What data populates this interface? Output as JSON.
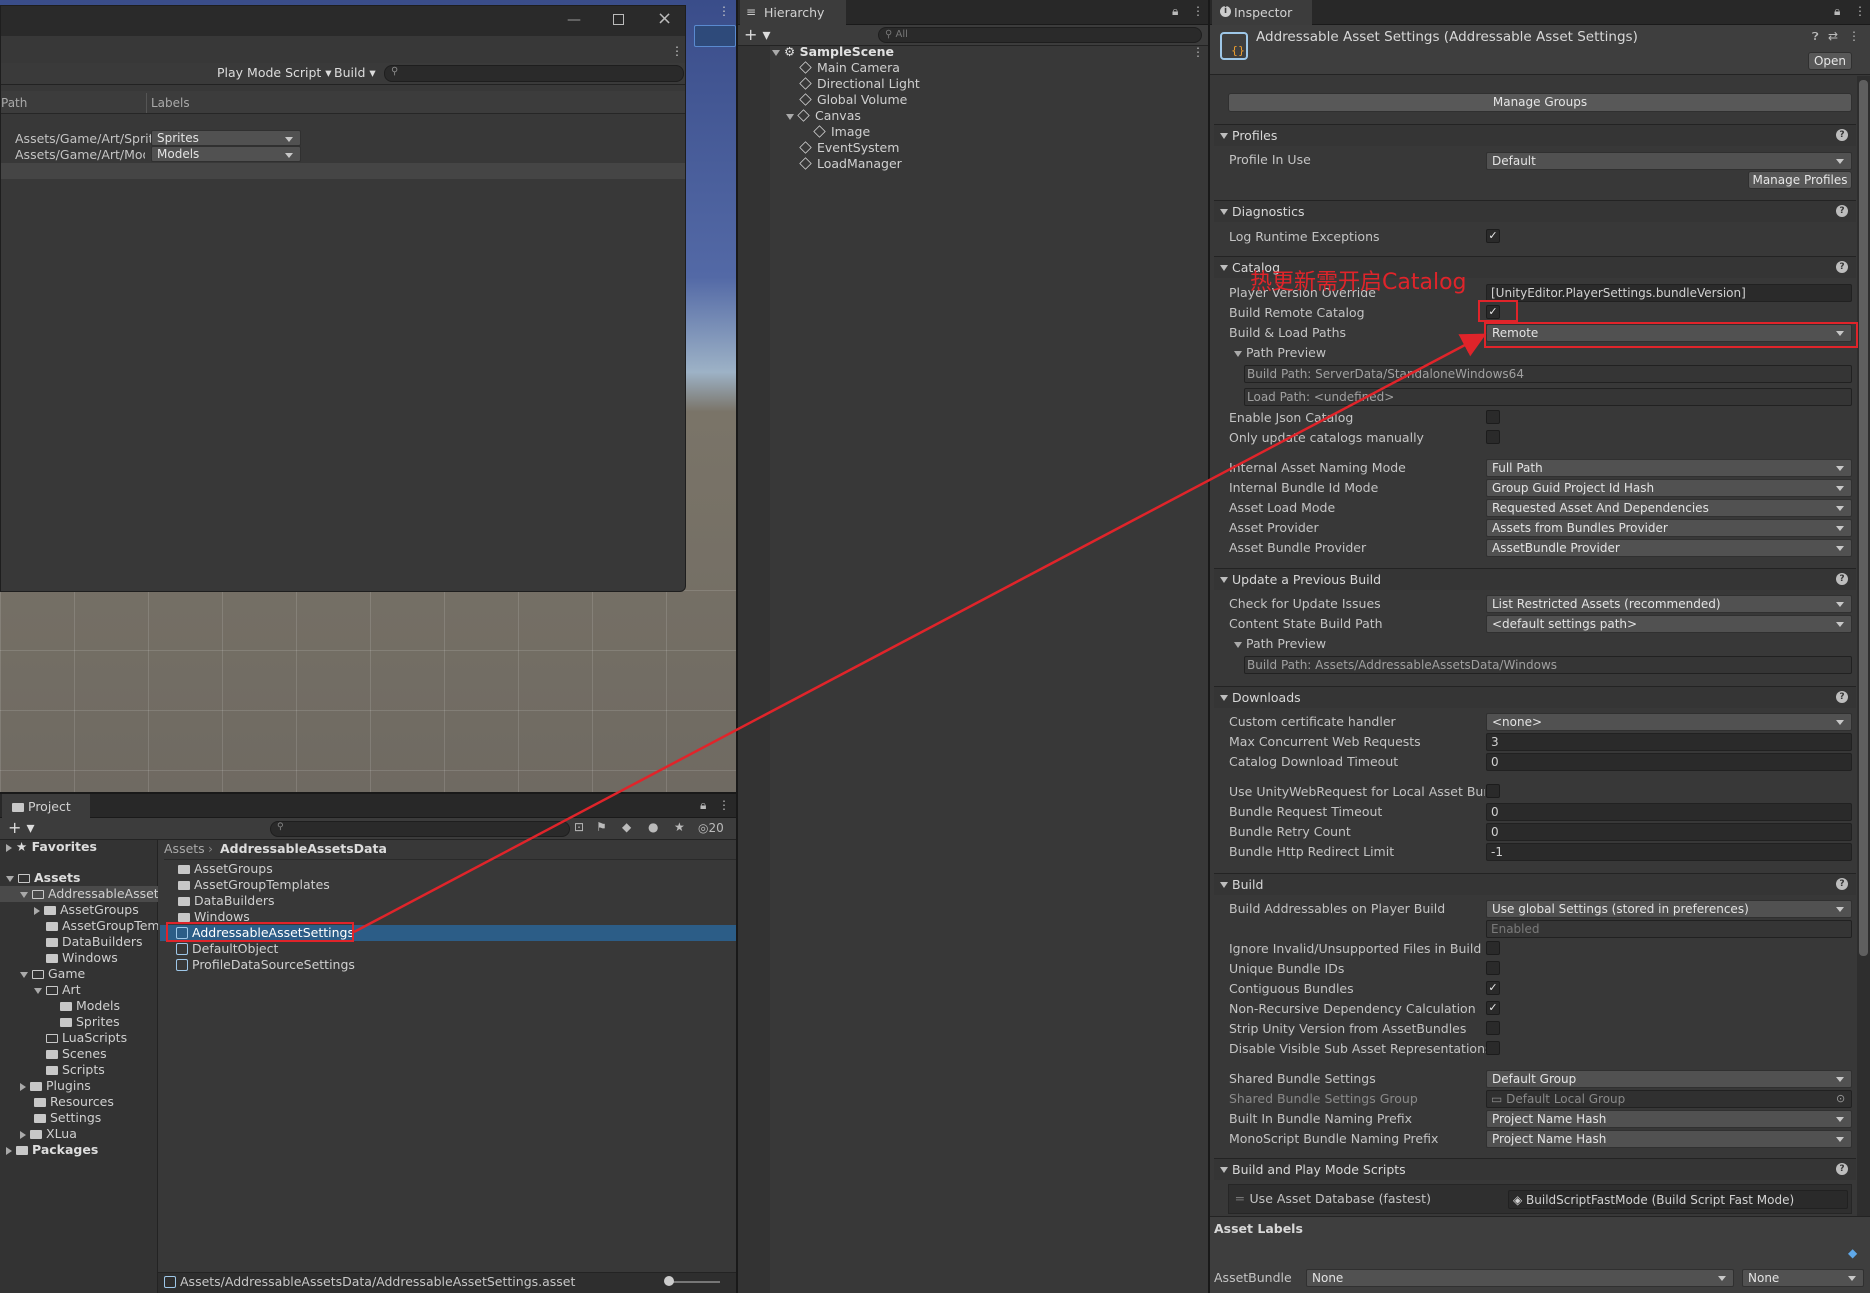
{
  "groups_window": {
    "toolbar": {
      "play_mode_script": "Play Mode Script",
      "build": "Build"
    },
    "columns": {
      "path": "Path",
      "labels": "Labels"
    },
    "rows": [
      {
        "path": "Assets/Game/Art/Sprit",
        "label": "Sprites"
      },
      {
        "path": "Assets/Game/Art/Mod",
        "label": "Models"
      }
    ]
  },
  "hierarchy": {
    "tab": "Hierarchy",
    "search_placeholder": "All",
    "scene": "SampleScene",
    "items": [
      "Main Camera",
      "Directional Light",
      "Global Volume",
      "Canvas",
      "Image",
      "EventSystem",
      "LoadManager"
    ]
  },
  "project": {
    "tab": "Project",
    "count": "20",
    "favorites": "Favorites",
    "assets": "Assets",
    "tree": [
      "AddressableAssets",
      "AssetGroups",
      "AssetGroupTemp",
      "DataBuilders",
      "Windows",
      "Game",
      "Art",
      "Models",
      "Sprites",
      "LuaScripts",
      "Scenes",
      "Scripts",
      "Plugins",
      "Resources",
      "Settings",
      "XLua",
      "Packages"
    ],
    "breadcrumb": {
      "root": "Assets",
      "current": "AddressableAssetsData"
    },
    "files": [
      "AssetGroups",
      "AssetGroupTemplates",
      "DataBuilders",
      "Windows",
      "AddressableAssetSettings",
      "DefaultObject",
      "ProfileDataSourceSettings"
    ],
    "status_path": "Assets/AddressableAssetsData/AddressableAssetSettings.asset"
  },
  "inspector": {
    "tab": "Inspector",
    "title": "Addressable Asset Settings (Addressable Asset Settings)",
    "open_button": "Open",
    "manage_groups": "Manage Groups",
    "profiles": {
      "header": "Profiles",
      "profile_in_use_label": "Profile In Use",
      "profile_in_use": "Default",
      "manage_profiles": "Manage Profiles"
    },
    "diagnostics": {
      "header": "Diagnostics",
      "log_runtime_exceptions": "Log Runtime Exceptions"
    },
    "catalog": {
      "header": "Catalog",
      "player_version_override_label": "Player Version Override",
      "player_version_override": "[UnityEditor.PlayerSettings.bundleVersion]",
      "build_remote_catalog": "Build Remote Catalog",
      "build_load_paths_label": "Build & Load Paths",
      "build_load_paths": "Remote",
      "path_preview": "Path Preview",
      "build_path": "Build Path: ServerData/StandaloneWindows64",
      "load_path": "Load Path: <undefined>",
      "enable_json_catalog": "Enable Json Catalog",
      "only_update_manually": "Only update catalogs manually",
      "internal_asset_naming_mode_label": "Internal Asset Naming Mode",
      "internal_asset_naming_mode": "Full Path",
      "internal_bundle_id_mode_label": "Internal Bundle Id Mode",
      "internal_bundle_id_mode": "Group Guid Project Id Hash",
      "asset_load_mode_label": "Asset Load Mode",
      "asset_load_mode": "Requested Asset And Dependencies",
      "asset_provider_label": "Asset Provider",
      "asset_provider": "Assets from Bundles Provider",
      "asset_bundle_provider_label": "Asset Bundle Provider",
      "asset_bundle_provider": "AssetBundle Provider"
    },
    "update_previous": {
      "header": "Update a Previous Build",
      "check_label": "Check for Update Issues",
      "check": "List Restricted Assets (recommended)",
      "content_state_label": "Content State Build Path",
      "content_state": "<default settings path>",
      "path_preview": "Path Preview",
      "build_path": "Build Path: Assets/AddressableAssetsData/Windows"
    },
    "downloads": {
      "header": "Downloads",
      "cert_label": "Custom certificate handler",
      "cert": "<none>",
      "max_requests_label": "Max Concurrent Web Requests",
      "max_requests": "3",
      "catalog_timeout_label": "Catalog Download Timeout",
      "catalog_timeout": "0",
      "use_uwr_label": "Use UnityWebRequest for Local Asset Bundles",
      "bundle_timeout_label": "Bundle Request Timeout",
      "bundle_timeout": "0",
      "retry_label": "Bundle Retry Count",
      "retry": "0",
      "redirect_label": "Bundle Http Redirect Limit",
      "redirect": "-1"
    },
    "build": {
      "header": "Build",
      "on_player_build_label": "Build Addressables on Player Build",
      "on_player_build": "Use global Settings (stored in preferences)",
      "enabled": "Enabled",
      "ignore_invalid": "Ignore Invalid/Unsupported Files in Build",
      "unique_ids": "Unique Bundle IDs",
      "contiguous": "Contiguous Bundles",
      "non_recursive": "Non-Recursive Dependency Calculation",
      "strip_version": "Strip Unity Version from AssetBundles",
      "disable_visible_sub": "Disable Visible Sub Asset Representations",
      "shared_bundle_label": "Shared Bundle Settings",
      "shared_bundle": "Default Group",
      "shared_group_label": "Shared Bundle Settings Group",
      "shared_group": "Default Local Group",
      "builtin_prefix_label": "Built In Bundle Naming Prefix",
      "builtin_prefix": "Project Name Hash",
      "monoscript_prefix_label": "MonoScript Bundle Naming Prefix",
      "monoscript_prefix": "Project Name Hash"
    },
    "play_mode_scripts": {
      "header": "Build and Play Mode Scripts",
      "item_label": "Use Asset Database (fastest)",
      "item_value": "BuildScriptFastMode (Build Script Fast Mode)"
    },
    "asset_labels": {
      "header": "Asset Labels",
      "bundle_label": "AssetBundle",
      "bundle": "None",
      "variant": "None"
    }
  },
  "annotation": {
    "text": "热更新需开启Catalog",
    "color": "#e0242a"
  }
}
